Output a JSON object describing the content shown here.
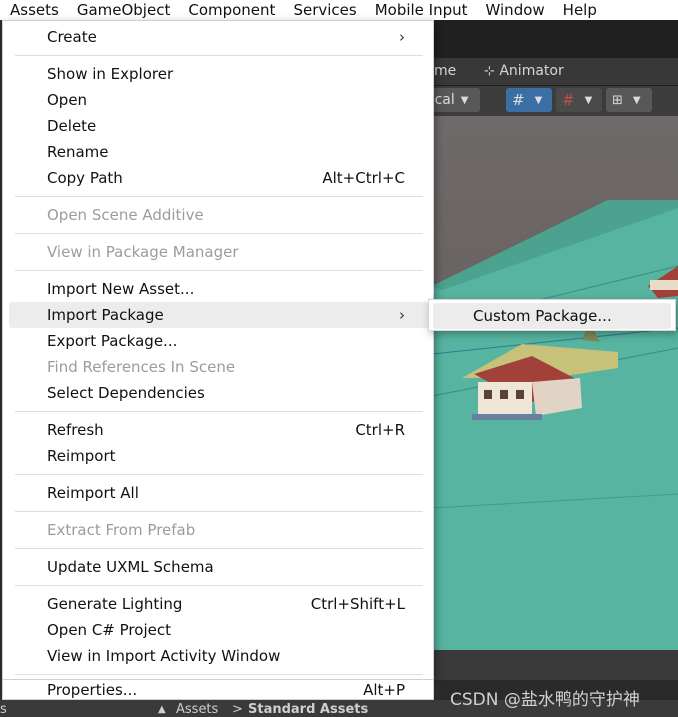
{
  "menubar": {
    "items": [
      "Assets",
      "GameObject",
      "Component",
      "Services",
      "Mobile Input",
      "Window",
      "Help"
    ]
  },
  "editor": {
    "tab_scene_fragment": "me",
    "tab_animator": "Animator",
    "toolbar_local": "ocal"
  },
  "context_menu": {
    "items": [
      {
        "label": "Create",
        "shortcut": "",
        "submenu": true,
        "enabled": true
      },
      {
        "label": "Show in Explorer",
        "shortcut": "",
        "enabled": true
      },
      {
        "label": "Open",
        "shortcut": "",
        "enabled": true
      },
      {
        "label": "Delete",
        "shortcut": "",
        "enabled": true
      },
      {
        "label": "Rename",
        "shortcut": "",
        "enabled": true
      },
      {
        "label": "Copy Path",
        "shortcut": "Alt+Ctrl+C",
        "enabled": true
      },
      {
        "label": "Open Scene Additive",
        "shortcut": "",
        "enabled": false
      },
      {
        "label": "View in Package Manager",
        "shortcut": "",
        "enabled": false
      },
      {
        "label": "Import New Asset...",
        "shortcut": "",
        "enabled": true
      },
      {
        "label": "Import Package",
        "shortcut": "",
        "submenu": true,
        "enabled": true,
        "highlighted": true
      },
      {
        "label": "Export Package...",
        "shortcut": "",
        "enabled": true
      },
      {
        "label": "Find References In Scene",
        "shortcut": "",
        "enabled": false
      },
      {
        "label": "Select Dependencies",
        "shortcut": "",
        "enabled": true
      },
      {
        "label": "Refresh",
        "shortcut": "Ctrl+R",
        "enabled": true
      },
      {
        "label": "Reimport",
        "shortcut": "",
        "enabled": true
      },
      {
        "label": "Reimport All",
        "shortcut": "",
        "enabled": true
      },
      {
        "label": "Extract From Prefab",
        "shortcut": "",
        "enabled": false
      },
      {
        "label": "Update UXML Schema",
        "shortcut": "",
        "enabled": true
      },
      {
        "label": "Generate Lighting",
        "shortcut": "Ctrl+Shift+L",
        "enabled": true
      },
      {
        "label": "Open C# Project",
        "shortcut": "",
        "enabled": true
      },
      {
        "label": "View in Import Activity Window",
        "shortcut": "",
        "enabled": true
      },
      {
        "label": "Properties...",
        "shortcut": "Alt+P",
        "enabled": true
      }
    ],
    "submenu_arrow": "›"
  },
  "submenu": {
    "items": [
      {
        "label": "Custom Package..."
      }
    ]
  },
  "bottom_bar": {
    "left_fragment": "s",
    "breadcrumb_1": "Assets",
    "breadcrumb_sep": ">",
    "breadcrumb_2": "Standard Assets"
  },
  "watermark": "CSDN @盐水鸭的守护神",
  "colors": {
    "ground": "#55b5a0",
    "sky_ground": "#6b5f5c",
    "menu_bg": "#ffffff",
    "highlight": "#ececec",
    "disabled_text": "#9c9c9c",
    "toolbar_active": "#3b6ea5"
  }
}
